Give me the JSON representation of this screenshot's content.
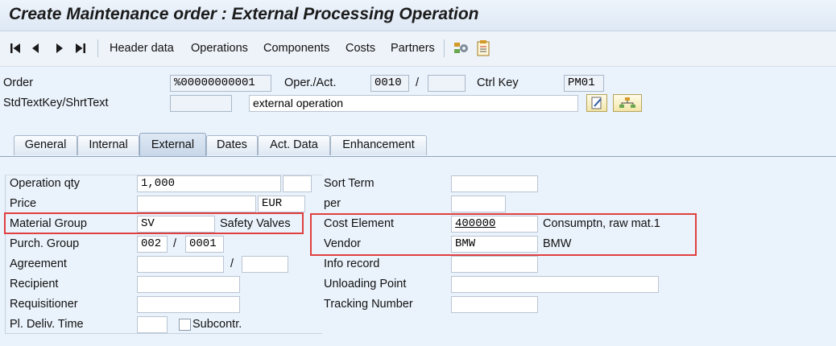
{
  "window": {
    "title": "Create Maintenance order : External Processing Operation"
  },
  "toolbar": {
    "nav_buttons": [
      "first-icon",
      "previous-icon",
      "next-icon",
      "last-icon"
    ],
    "items": [
      "Header data",
      "Operations",
      "Components",
      "Costs",
      "Partners"
    ],
    "icons": [
      "settings-icon",
      "document-icon"
    ]
  },
  "header": {
    "order_label": "Order",
    "order_value": "%00000000001",
    "oper_act_label": "Oper./Act.",
    "oper_act_value": "0010",
    "oper_act_sep": "/",
    "oper_act_sub_value": "",
    "ctrl_key_label": "Ctrl Key",
    "ctrl_key_value": "PM01",
    "stdtextkey_label": "StdTextKey/ShrtText",
    "stdtextkey_value": "",
    "short_text_value": "external operation"
  },
  "tabs": {
    "items": [
      "General",
      "Internal",
      "External",
      "Dates",
      "Act. Data",
      "Enhancement"
    ],
    "active": "External"
  },
  "external": {
    "operation_qty_label": "Operation qty",
    "operation_qty_value": "1,000",
    "operation_qty_unit": "",
    "price_label": "Price",
    "price_value": "",
    "price_currency": "EUR",
    "material_group_label": "Material Group",
    "material_group_value": "SV",
    "material_group_desc": "Safety Valves",
    "purch_group_label": "Purch. Group",
    "purch_group_value": "002",
    "purch_org_sep": "/",
    "purch_org_value": "0001",
    "agreement_label": "Agreement",
    "agreement_value": "",
    "agreement_sep": "/",
    "agreement_item": "",
    "recipient_label": "Recipient",
    "recipient_value": "",
    "requisitioner_label": "Requisitioner",
    "requisitioner_value": "",
    "pl_deliv_time_label": "Pl. Deliv. Time",
    "pl_deliv_time_value": "",
    "subcontr_label": "Subcontr.",
    "sort_term_label": "Sort Term",
    "sort_term_value": "",
    "per_label": "per",
    "per_value": "",
    "cost_element_label": "Cost Element",
    "cost_element_value": "400000",
    "cost_element_desc": "Consumptn, raw mat.1",
    "vendor_label": "Vendor",
    "vendor_value": "BMW",
    "vendor_desc": "BMW",
    "info_record_label": "Info record",
    "info_record_value": "",
    "unloading_point_label": "Unloading Point",
    "unloading_point_value": "",
    "tracking_number_label": "Tracking Number",
    "tracking_number_value": ""
  },
  "colors": {
    "highlight": "#e0403f",
    "background": "#eaf2fb"
  }
}
